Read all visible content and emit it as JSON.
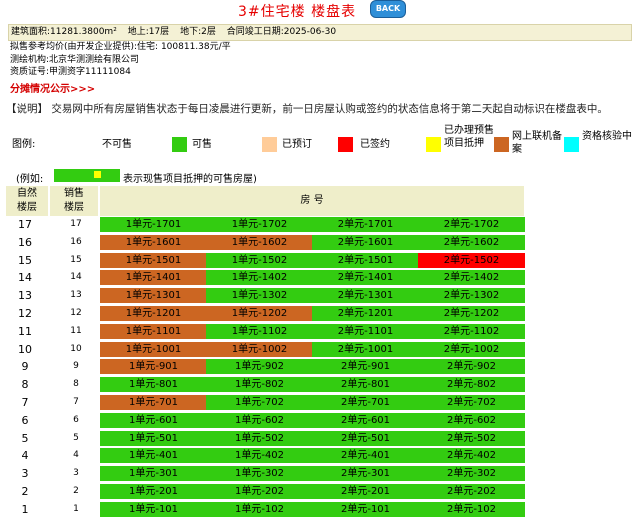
{
  "header": {
    "title": "3#住宅楼  楼盘表",
    "back_label": "BACK"
  },
  "info": {
    "area": "建筑面积:11281.3800m²",
    "above": "地上:17层",
    "below": "地下:2层",
    "date": "合同竣工日期:2025-06-30",
    "price": "拟售参考均价(由开发企业提供):住宅:  100811.38元/平",
    "survey_org": "测绘机构:北京华测测绘有限公司",
    "cert": "资质证号:甲测资字11111084",
    "fenzhen": "分摊情况公示>>>"
  },
  "note": "【说明】 交易网中所有房屋销售状态于每日凌晨进行更新，前一日房屋认购或签约的状态信息将于第二天起自动标识在楼盘表中。",
  "legend": {
    "label": "图例:",
    "items": [
      {
        "text": "不可售",
        "color": "#ffffff"
      },
      {
        "text": "可售",
        "color": "#33cc11"
      },
      {
        "text": "已预订",
        "color": "#ffcc99"
      },
      {
        "text": "已签约",
        "color": "#ff0000"
      },
      {
        "text": "已办理预售项目抵押",
        "color": "#ffff00"
      },
      {
        "text": "网上联机备案",
        "color": "#cc6622"
      },
      {
        "text": "资格核验中",
        "color": "#00ffff"
      }
    ]
  },
  "example": {
    "prefix": "(例如:",
    "suffix": "表示现售项目抵押的可售房屋)"
  },
  "table": {
    "col_floor": "自然楼层",
    "col_sale": "销售楼层",
    "col_room": "房 号",
    "rows": [
      {
        "f": "17",
        "s": "17",
        "rooms": [
          [
            "1单元-1701",
            "g"
          ],
          [
            "1单元-1702",
            "g"
          ],
          [
            "2单元-1701",
            "g"
          ],
          [
            "2单元-1702",
            "g"
          ]
        ]
      },
      {
        "f": "16",
        "s": "16",
        "rooms": [
          [
            "1单元-1601",
            "o"
          ],
          [
            "1单元-1602",
            "o"
          ],
          [
            "2单元-1601",
            "g"
          ],
          [
            "2单元-1602",
            "g"
          ]
        ]
      },
      {
        "f": "15",
        "s": "15",
        "rooms": [
          [
            "1单元-1501",
            "o"
          ],
          [
            "1单元-1502",
            "g"
          ],
          [
            "2单元-1501",
            "g"
          ],
          [
            "2单元-1502",
            "r"
          ]
        ]
      },
      {
        "f": "14",
        "s": "14",
        "rooms": [
          [
            "1单元-1401",
            "o"
          ],
          [
            "1单元-1402",
            "g"
          ],
          [
            "2单元-1401",
            "g"
          ],
          [
            "2单元-1402",
            "g"
          ]
        ]
      },
      {
        "f": "13",
        "s": "13",
        "rooms": [
          [
            "1单元-1301",
            "o"
          ],
          [
            "1单元-1302",
            "g"
          ],
          [
            "2单元-1301",
            "g"
          ],
          [
            "2单元-1302",
            "g"
          ]
        ]
      },
      {
        "f": "12",
        "s": "12",
        "rooms": [
          [
            "1单元-1201",
            "o"
          ],
          [
            "1单元-1202",
            "o"
          ],
          [
            "2单元-1201",
            "g"
          ],
          [
            "2单元-1202",
            "g"
          ]
        ]
      },
      {
        "f": "11",
        "s": "11",
        "rooms": [
          [
            "1单元-1101",
            "o"
          ],
          [
            "1单元-1102",
            "g"
          ],
          [
            "2单元-1101",
            "g"
          ],
          [
            "2单元-1102",
            "g"
          ]
        ]
      },
      {
        "f": "10",
        "s": "10",
        "rooms": [
          [
            "1单元-1001",
            "o"
          ],
          [
            "1单元-1002",
            "o"
          ],
          [
            "2单元-1001",
            "g"
          ],
          [
            "2单元-1002",
            "g"
          ]
        ]
      },
      {
        "f": "9",
        "s": "9",
        "rooms": [
          [
            "1单元-901",
            "o"
          ],
          [
            "1单元-902",
            "g"
          ],
          [
            "2单元-901",
            "g"
          ],
          [
            "2单元-902",
            "g"
          ]
        ]
      },
      {
        "f": "8",
        "s": "8",
        "rooms": [
          [
            "1单元-801",
            "g"
          ],
          [
            "1单元-802",
            "g"
          ],
          [
            "2单元-801",
            "g"
          ],
          [
            "2单元-802",
            "g"
          ]
        ]
      },
      {
        "f": "7",
        "s": "7",
        "rooms": [
          [
            "1单元-701",
            "o"
          ],
          [
            "1单元-702",
            "g"
          ],
          [
            "2单元-701",
            "g"
          ],
          [
            "2单元-702",
            "g"
          ]
        ]
      },
      {
        "f": "6",
        "s": "6",
        "rooms": [
          [
            "1单元-601",
            "g"
          ],
          [
            "1单元-602",
            "g"
          ],
          [
            "2单元-601",
            "g"
          ],
          [
            "2单元-602",
            "g"
          ]
        ]
      },
      {
        "f": "5",
        "s": "5",
        "rooms": [
          [
            "1单元-501",
            "g"
          ],
          [
            "1单元-502",
            "g"
          ],
          [
            "2单元-501",
            "g"
          ],
          [
            "2单元-502",
            "g"
          ]
        ]
      },
      {
        "f": "4",
        "s": "4",
        "rooms": [
          [
            "1单元-401",
            "g"
          ],
          [
            "1单元-402",
            "g"
          ],
          [
            "2单元-401",
            "g"
          ],
          [
            "2单元-402",
            "g"
          ]
        ]
      },
      {
        "f": "3",
        "s": "3",
        "rooms": [
          [
            "1单元-301",
            "g"
          ],
          [
            "1单元-302",
            "g"
          ],
          [
            "2单元-301",
            "g"
          ],
          [
            "2单元-302",
            "g"
          ]
        ]
      },
      {
        "f": "2",
        "s": "2",
        "rooms": [
          [
            "1单元-201",
            "g"
          ],
          [
            "1单元-202",
            "g"
          ],
          [
            "2单元-201",
            "g"
          ],
          [
            "2单元-202",
            "g"
          ]
        ]
      },
      {
        "f": "1",
        "s": "1",
        "rooms": [
          [
            "1单元-101",
            "g"
          ],
          [
            "1单元-102",
            "g"
          ],
          [
            "2单元-101",
            "g"
          ],
          [
            "2单元-102",
            "g"
          ]
        ]
      }
    ]
  }
}
